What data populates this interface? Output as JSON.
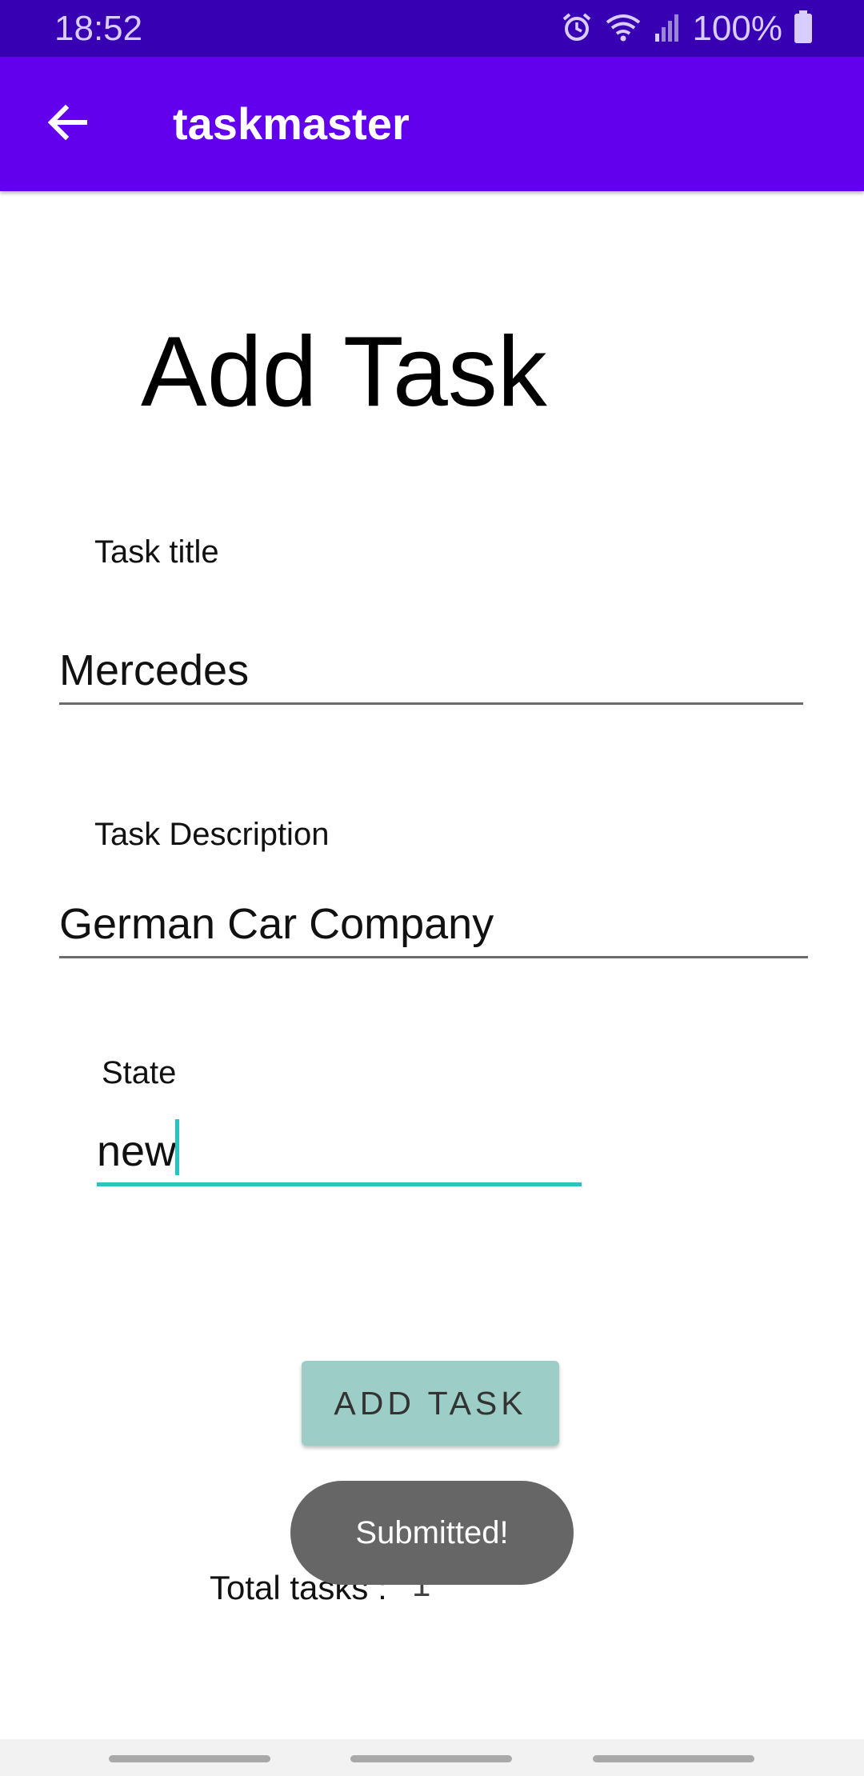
{
  "status_bar": {
    "time": "18:52",
    "battery": "100%",
    "icons": [
      "alarm-icon",
      "wifi-icon",
      "signal-icon",
      "battery-icon"
    ]
  },
  "app_bar": {
    "title": "taskmaster",
    "back_icon": "arrow-left-icon",
    "color": "#6200ee"
  },
  "form": {
    "heading": "Add Task",
    "title_label": "Task title",
    "title_value": "Mercedes",
    "description_label": "Task Description",
    "description_value": "German Car Company",
    "state_label": "State",
    "state_value": "new",
    "accent_color": "#26c6c0"
  },
  "actions": {
    "add_task_label": "ADD TASK"
  },
  "summary": {
    "total_label": "Total tasks :",
    "total_value": "1"
  },
  "toast": {
    "message": "Submitted!"
  }
}
